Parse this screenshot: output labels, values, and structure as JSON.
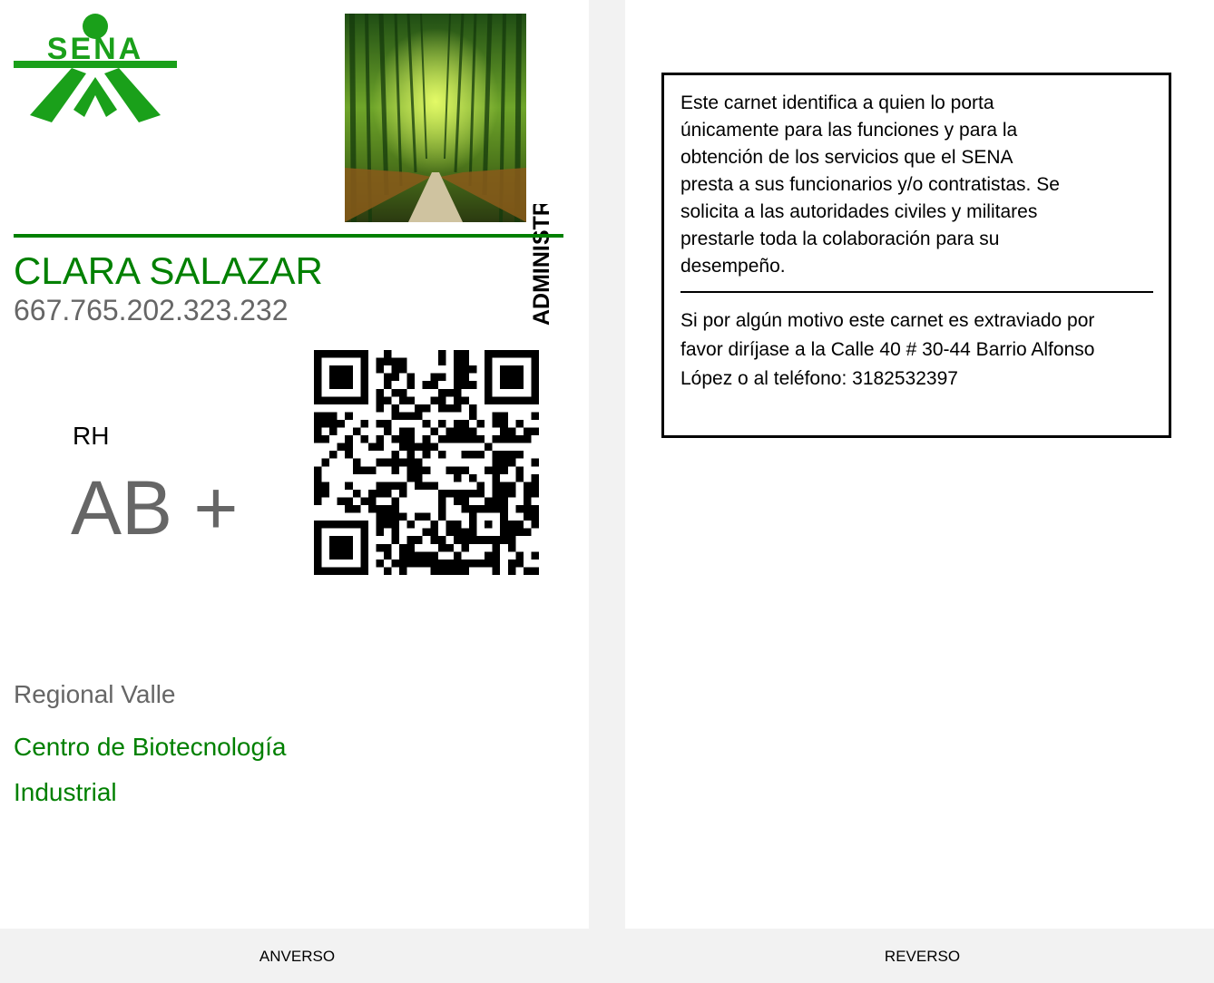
{
  "colors": {
    "brand_green": "#008000",
    "logo_green": "#1aa01a",
    "gray_text": "#666666",
    "page_bg": "#f2f2f2",
    "card_bg": "#ffffff"
  },
  "front": {
    "logo_text": "SENA",
    "photo_icon": "bamboo-forest-photo",
    "vertical_text": "ADMINISTRACIÓN",
    "name": "CLARA SALAZAR",
    "document_number": "667.765.202.323.232",
    "rh_label": "RH",
    "rh_value": "AB +",
    "qr_icon": "qr-code-icon",
    "regional": "Regional Valle",
    "center": "Centro de Biotecnología Industrial"
  },
  "back": {
    "paragraph1": "Este carnet identifica a quien lo porta únicamente para las funciones y para la obtención de los servicios que el SENA presta a sus funcionarios y/o contratistas. Se solicita a las autoridades civiles y militares prestarle toda la colaboración para su desempeño.",
    "paragraph2": "Si por algún motivo este carnet es extraviado por favor diríjase a la Calle 40 # 30-44 Barrio Alfonso López o al teléfono: 3182532397"
  },
  "footer": {
    "front_label": "ANVERSO",
    "back_label": "REVERSO"
  }
}
